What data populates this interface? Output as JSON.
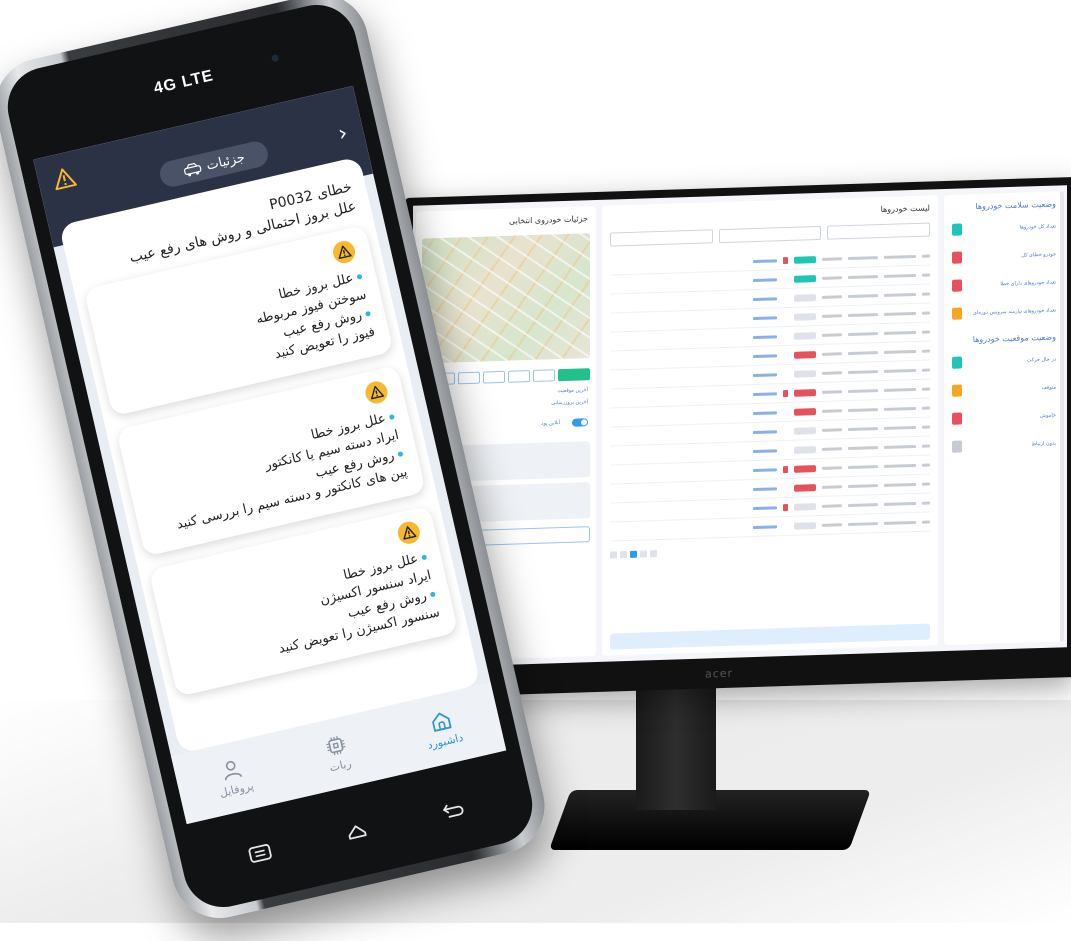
{
  "monitor": {
    "brand": "acer",
    "left_pane": {
      "title": "جزئیات خودروی انتخابی",
      "info_1": "آخرین موقعیت",
      "info_2": "آخرین بروزرسانی",
      "toggle_label": "آنلاین بود"
    },
    "mid_pane": {
      "title": "لیست خودروها"
    },
    "right_pane": {
      "section_1": "وضعیت سلامت خودروها",
      "items": [
        {
          "label": "تعداد کل خودروها",
          "color": "#1fc6b7"
        },
        {
          "label": "خودرو خطای کل",
          "color": "#e8505b"
        },
        {
          "label": "تعداد خودروهای دارای خطا",
          "color": "#e8505b"
        },
        {
          "label": "تعداد خودروهای نیازمند سرویس دوره‌ای",
          "color": "#f5a623"
        }
      ],
      "section_2": "وضعیت موقعیت خودروها",
      "items_2": [
        {
          "label": "در حال حرکت",
          "color": "#1fc6b7"
        },
        {
          "label": "متوقف",
          "color": "#f5a623"
        },
        {
          "label": "خاموش",
          "color": "#e8505b"
        },
        {
          "label": "بدون ارتباط",
          "color": "#c7ccd4"
        }
      ]
    }
  },
  "phone": {
    "network": "4G LTE",
    "header_title": "جزئیات",
    "back_chevron": "›",
    "fault_title": "خطای P0032",
    "fault_subtitle": "علل بروز احتمالی و روش های رفع عیب",
    "faults": [
      {
        "cause_heading": "علل بروز خطا",
        "cause": "سوختن فیوز مربوطه",
        "fix_heading": "روش رفع عیب",
        "fix": "فیوز را تعویض کنید"
      },
      {
        "cause_heading": "علل بروز خطا",
        "cause": "ایراد دسته سیم یا کانکتور",
        "fix_heading": "روش رفع عیب",
        "fix": "پین های کانکتور و دسته سیم را بررسی کنید"
      },
      {
        "cause_heading": "علل بروز خطا",
        "cause": "ایراد سنسور اکسیژن",
        "fix_heading": "روش رفع عیب",
        "fix": "سنسور اکسیژن را تعویض کنید"
      }
    ],
    "nav": [
      {
        "label": "داشبورد",
        "icon": "home-icon",
        "active": true
      },
      {
        "label": "ربات",
        "icon": "chip-icon",
        "active": false
      },
      {
        "label": "پروفایل",
        "icon": "user-icon",
        "active": false
      }
    ],
    "accent": "#f5b82e",
    "header_color": "#2b3246"
  }
}
